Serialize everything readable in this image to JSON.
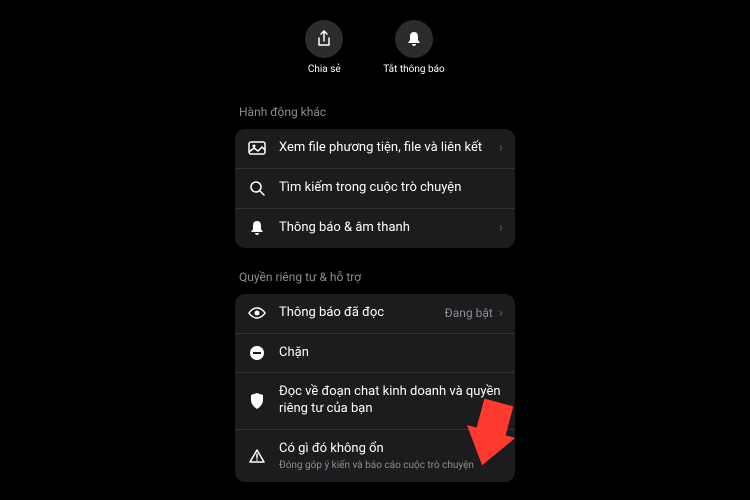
{
  "topActions": {
    "share": {
      "label": "Chia sẻ"
    },
    "mute": {
      "label": "Tắt thông báo"
    }
  },
  "sections": {
    "actions": {
      "header": "Hành động khác",
      "media": {
        "label": "Xem file phương tiện, file và liên kết"
      },
      "search": {
        "label": "Tìm kiếm trong cuộc trò chuyện"
      },
      "notifications": {
        "label": "Thông báo & âm thanh"
      }
    },
    "privacy": {
      "header": "Quyền riêng tư & hỗ trợ",
      "readReceipts": {
        "label": "Thông báo đã đọc",
        "value": "Đang bật"
      },
      "block": {
        "label": "Chặn"
      },
      "privacyInfo": {
        "label": "Đọc về đoạn chat kinh doanh và quyền riêng tư của bạn"
      },
      "report": {
        "label": "Có gì đó không ổn",
        "subtitle": "Đóng góp ý kiến và báo cáo cuộc trò chuyện"
      }
    }
  }
}
